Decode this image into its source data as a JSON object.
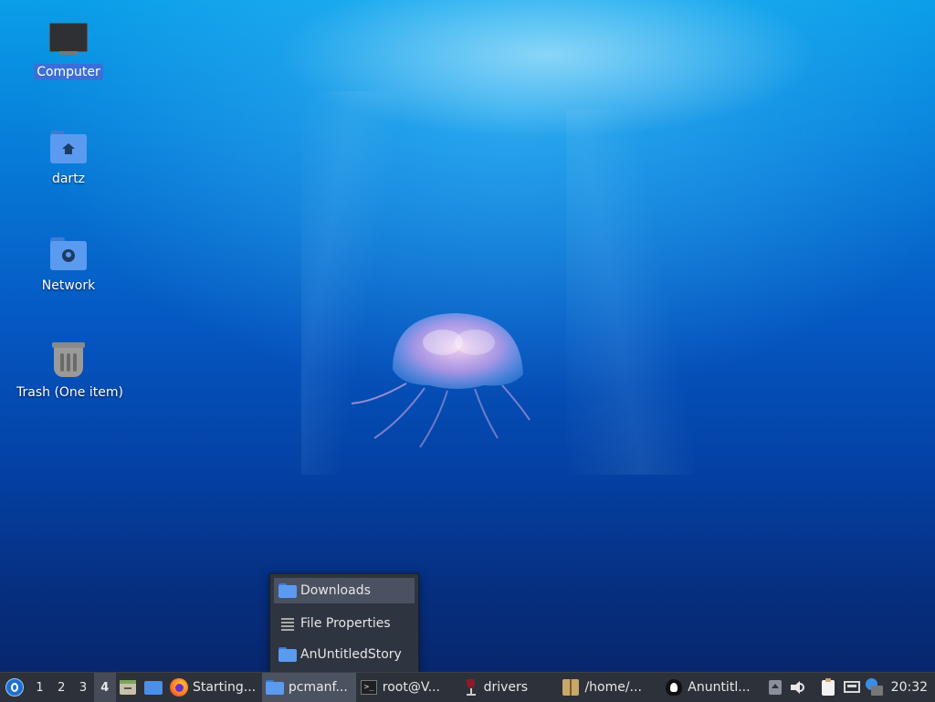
{
  "desktop": {
    "icons": [
      {
        "label": "Computer",
        "icon": "computer-monitor-icon",
        "selected": true
      },
      {
        "label": "dartz",
        "icon": "home-folder-icon"
      },
      {
        "label": "Network",
        "icon": "network-folder-icon"
      },
      {
        "label": "Trash (One item)",
        "icon": "trash-full-icon"
      }
    ]
  },
  "menu": {
    "items": [
      {
        "label": "Downloads",
        "icon": "folder-icon",
        "highlighted": true
      },
      {
        "label": "File Properties",
        "icon": "list-icon"
      },
      {
        "label": "AnUntitledStory",
        "icon": "folder-icon"
      }
    ]
  },
  "taskbar": {
    "start_icon": "lxqt-start-menu-icon",
    "workspaces": [
      "1",
      "2",
      "3",
      "4"
    ],
    "active_workspace": "4",
    "quicklaunch": [
      "file-manager-icon",
      "show-desktop-icon"
    ],
    "tasks": [
      {
        "label": "Starting...",
        "icon": "firefox-icon"
      },
      {
        "label": "pcmanf...",
        "icon": "folder-icon",
        "active": true
      },
      {
        "label": "root@V...",
        "icon": "terminal-icon"
      },
      {
        "label": "drivers",
        "icon": "wine-icon"
      },
      {
        "label": "/home/...",
        "icon": "archive-icon"
      },
      {
        "label": "Anuntitl...",
        "icon": "inkscape-icon"
      }
    ],
    "tray": [
      "scroll-up-icon",
      "volume-icon",
      "clipboard-icon",
      "network-wired-icon",
      "update-notifier-icon"
    ],
    "clock": "20:32"
  },
  "colors": {
    "accent": "#3a6fd6",
    "panel": "#2d3139",
    "menu_bg": "#2e3440",
    "menu_highlight": "#4a5160",
    "folder": "#5a9bf0"
  }
}
